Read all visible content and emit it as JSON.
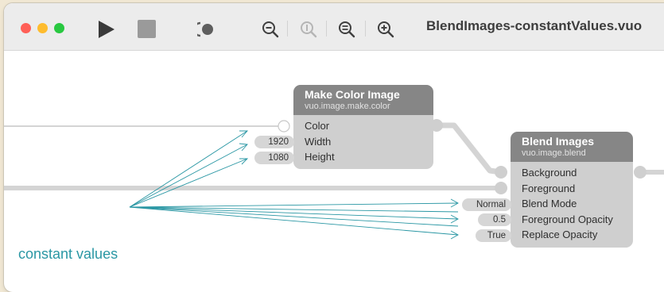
{
  "window": {
    "title": "BlendImages-constantValues.vuo"
  },
  "toolbar": {
    "buttons": [
      {
        "name": "run-button",
        "icon": "play-icon"
      },
      {
        "name": "stop-button",
        "icon": "stop-icon"
      },
      {
        "name": "show-events-button",
        "icon": "show-events-icon"
      },
      {
        "name": "zoom-out-button",
        "icon": "zoom-out-icon"
      },
      {
        "name": "zoom-actual-button",
        "icon": "zoom-actual-icon"
      },
      {
        "name": "zoom-to-fit-button",
        "icon": "zoom-to-fit-icon"
      },
      {
        "name": "zoom-in-button",
        "icon": "zoom-in-icon"
      }
    ]
  },
  "nodes": {
    "make_color_image": {
      "title": "Make Color Image",
      "class_name": "vuo.image.make.color",
      "ports": [
        "Color",
        "Width",
        "Height"
      ],
      "constants": {
        "width": "1920",
        "height": "1080"
      }
    },
    "blend_images": {
      "title": "Blend Images",
      "class_name": "vuo.image.blend",
      "ports": [
        "Background",
        "Foreground",
        "Blend Mode",
        "Foreground Opacity",
        "Replace Opacity"
      ],
      "constants": {
        "blend_mode": "Normal",
        "foreground_opacity": "0.5",
        "replace_opacity": "True"
      }
    }
  },
  "annotation": {
    "text": "constant values"
  },
  "colors": {
    "node_header": "#868686",
    "node_body": "#cfcfcf",
    "cable": "#d4d4d4",
    "annotation": "#2a97a4"
  }
}
